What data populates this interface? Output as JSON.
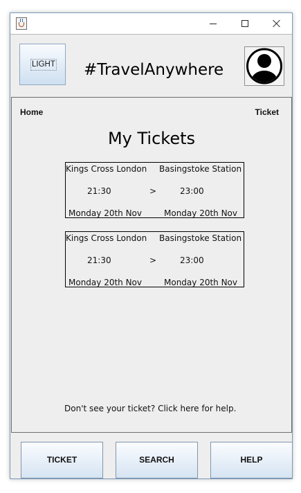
{
  "window": {
    "title": "",
    "controls": {
      "minimize": "minimize-icon",
      "maximize": "maximize-icon",
      "close": "close-icon"
    }
  },
  "header": {
    "theme_button_label": "LIGHT",
    "brand": "#TravelAnywhere",
    "avatar_icon": "user-avatar-icon"
  },
  "breadcrumb": {
    "left": "Home",
    "right": "Ticket"
  },
  "page_title": "My Tickets",
  "tickets": [
    {
      "from": "Kings Cross London",
      "to": "Basingstoke Station",
      "departure_time": "21:30",
      "arrow": ">",
      "arrival_time": "23:00",
      "departure_date": "Monday 20th Nov",
      "arrival_date": "Monday 20th Nov"
    },
    {
      "from": "Kings Cross London",
      "to": "Basingstoke Station",
      "departure_time": "21:30",
      "arrow": ">",
      "arrival_time": "23:00",
      "departure_date": "Monday 20th Nov",
      "arrival_date": "Monday 20th Nov"
    }
  ],
  "help_text": "Don't see your ticket? Click here for help.",
  "nav": {
    "ticket": "TICKET",
    "search": "SEARCH",
    "help": "HELP"
  },
  "colors": {
    "window_border": "#7a9ab8",
    "panel_background": "#eeeeee",
    "button_gradient_top": "#fafcff",
    "button_gradient_bottom": "#d6e4f2"
  }
}
